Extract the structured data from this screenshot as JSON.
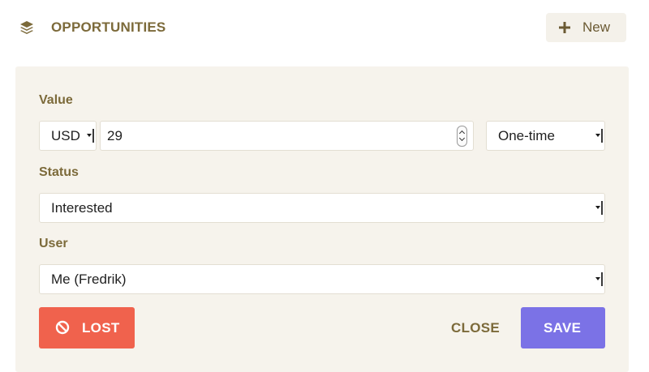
{
  "header": {
    "icon": "layers-icon",
    "title": "OPPORTUNITIES",
    "new_button": {
      "icon": "plus-icon",
      "label": "New"
    }
  },
  "form": {
    "value": {
      "label": "Value",
      "currency": "USD",
      "amount": "29",
      "frequency": "One-time"
    },
    "status": {
      "label": "Status",
      "selected": "Interested"
    },
    "user": {
      "label": "User",
      "selected": "Me (Fredrik)"
    }
  },
  "actions": {
    "lost": {
      "icon": "ban-icon",
      "label": "LOST"
    },
    "close": {
      "label": "CLOSE"
    },
    "save": {
      "label": "SAVE"
    }
  },
  "colors": {
    "accent_text": "#7c6a3a",
    "panel_bg": "#f6f3ec",
    "lost_bg": "#f0624d",
    "save_bg": "#7b72e6"
  }
}
